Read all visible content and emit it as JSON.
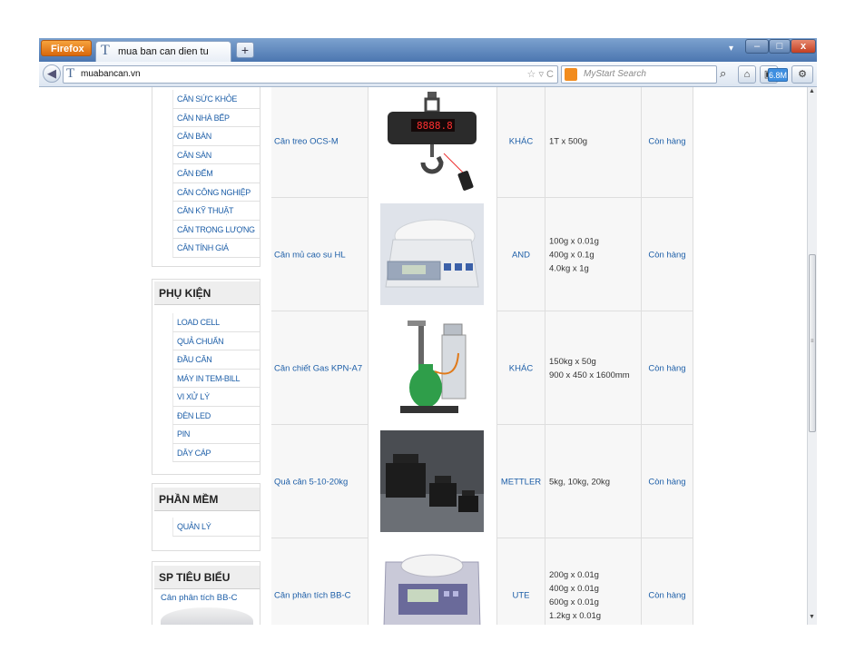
{
  "browser": {
    "app_button": "Firefox",
    "tab_title": "mua ban can dien tu",
    "new_tab": "+",
    "url": "muabancan.vn",
    "search_placeholder": "MyStart Search",
    "memory_badge": "6.8M",
    "window_min": "–",
    "window_max": "□",
    "window_close": "x"
  },
  "sidebar": {
    "categories": [
      "CÂN SỨC KHỎE",
      "CÂN NHÀ BẾP",
      "CÂN BÀN",
      "CÂN SÀN",
      "CÂN ĐẾM",
      "CÂN CÔNG NGHIỆP",
      "CÂN KỸ THUẬT",
      "CÂN TRỌNG LƯỢNG",
      "CÂN TÍNH GIÁ"
    ],
    "accessories_title": "PHỤ KIỆN",
    "accessories": [
      "LOAD CELL",
      "QUẢ CHUẨN",
      "ĐẦU CÂN",
      "MÁY IN TEM-BILL",
      "VI XỬ LÝ",
      "ĐÈN LED",
      "PIN",
      "DÂY CÁP"
    ],
    "software_title": "PHẦN MỀM",
    "software": [
      "QUẢN LÝ"
    ],
    "featured_title": "SP TIÊU BIỂU",
    "featured_item": "Cân phân tích BB-C"
  },
  "products": [
    {
      "name": "Cân treo OCS-M",
      "brand": "KHÁC",
      "spec": [
        "1T x 500g"
      ],
      "status": "Còn hàng",
      "image": "hanging-scale"
    },
    {
      "name": "Cân mủ cao su HL",
      "brand": "AND",
      "spec": [
        "100g x 0.01g",
        "400g x 0.1g",
        "4.0kg x 1g"
      ],
      "status": "Còn hàng",
      "image": "compact-scale"
    },
    {
      "name": "Cân chiết Gas KPN-A7",
      "brand": "KHÁC",
      "spec": [
        "150kg x 50g",
        "900 x 450 x 1600mm"
      ],
      "status": "Còn hàng",
      "image": "gas-filling-scale"
    },
    {
      "name": "Quả cân 5-10-20kg",
      "brand": "METTLER",
      "spec": [
        "5kg, 10kg, 20kg"
      ],
      "status": "Còn hàng",
      "image": "calibration-weights"
    },
    {
      "name": "Cân phân tích BB-C",
      "brand": "UTE",
      "spec": [
        "200g x 0.01g",
        "400g x 0.01g",
        "600g x 0.01g",
        "1.2kg x 0.01g"
      ],
      "status": "Còn hàng",
      "image": "analytical-balance"
    }
  ]
}
